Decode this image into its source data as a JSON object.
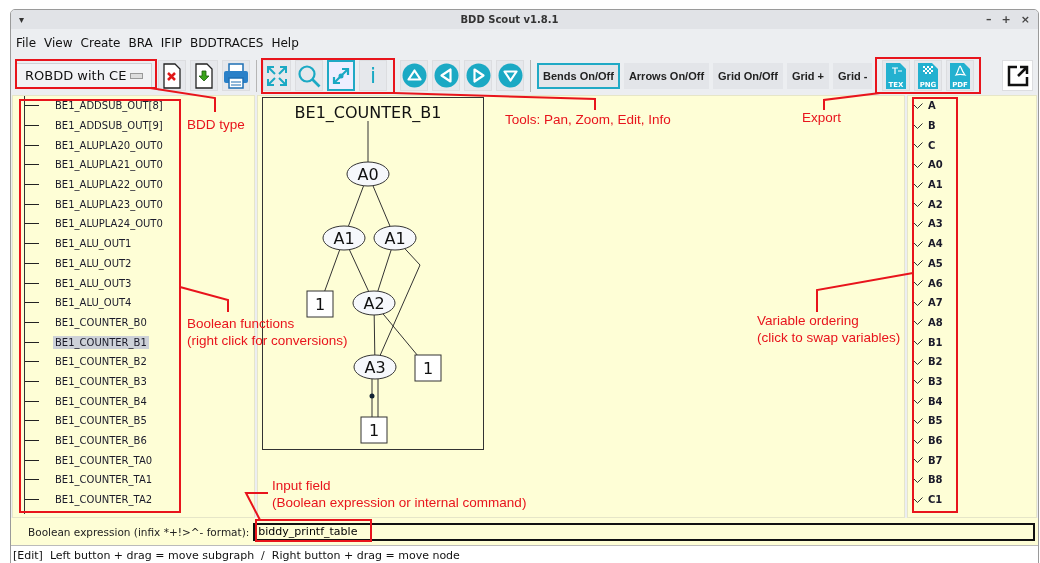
{
  "window": {
    "title": "BDD Scout v1.8.1",
    "menu_glyph": "▾",
    "controls": [
      "–",
      "+",
      "×"
    ]
  },
  "menu": [
    "File",
    "View",
    "Create",
    "BRA",
    "IFIP",
    "BDDTRACES",
    "Help"
  ],
  "toolbar": {
    "bdd_type": "ROBDD with CE",
    "file_buttons": [
      {
        "kind": "delete"
      },
      {
        "kind": "import"
      },
      {
        "kind": "print"
      }
    ],
    "tools": [
      {
        "kind": "pan",
        "selected": false
      },
      {
        "kind": "zoom",
        "selected": false
      },
      {
        "kind": "edit",
        "selected": true
      },
      {
        "kind": "info",
        "label": "i",
        "selected": false
      }
    ],
    "navigation": [
      {
        "kind": "up"
      },
      {
        "kind": "left"
      },
      {
        "kind": "right"
      },
      {
        "kind": "down"
      }
    ],
    "toggles": [
      {
        "label": "Bends On/Off",
        "selected": true
      },
      {
        "label": "Arrows On/Off",
        "selected": false
      },
      {
        "label": "Grid On/Off",
        "selected": false
      },
      {
        "label": "Grid +",
        "selected": false
      },
      {
        "label": "Grid -",
        "selected": false
      }
    ],
    "export": [
      {
        "label": "TEX",
        "kind": "tex"
      },
      {
        "label": "PNG",
        "kind": "png"
      },
      {
        "label": "PDF",
        "kind": "pdf"
      }
    ]
  },
  "functions": [
    {
      "label": "BE1_ADDSUB_OUT[8]",
      "selected": false
    },
    {
      "label": "BE1_ADDSUB_OUT[9]",
      "selected": false
    },
    {
      "label": "BE1_ALUPLA20_OUT0",
      "selected": false
    },
    {
      "label": "BE1_ALUPLA21_OUT0",
      "selected": false
    },
    {
      "label": "BE1_ALUPLA22_OUT0",
      "selected": false
    },
    {
      "label": "BE1_ALUPLA23_OUT0",
      "selected": false
    },
    {
      "label": "BE1_ALUPLA24_OUT0",
      "selected": false
    },
    {
      "label": "BE1_ALU_OUT1",
      "selected": false
    },
    {
      "label": "BE1_ALU_OUT2",
      "selected": false
    },
    {
      "label": "BE1_ALU_OUT3",
      "selected": false
    },
    {
      "label": "BE1_ALU_OUT4",
      "selected": false
    },
    {
      "label": "BE1_COUNTER_B0",
      "selected": false
    },
    {
      "label": "BE1_COUNTER_B1",
      "selected": true
    },
    {
      "label": "BE1_COUNTER_B2",
      "selected": false
    },
    {
      "label": "BE1_COUNTER_B3",
      "selected": false
    },
    {
      "label": "BE1_COUNTER_B4",
      "selected": false
    },
    {
      "label": "BE1_COUNTER_B5",
      "selected": false
    },
    {
      "label": "BE1_COUNTER_B6",
      "selected": false
    },
    {
      "label": "BE1_COUNTER_TA0",
      "selected": false
    },
    {
      "label": "BE1_COUNTER_TA1",
      "selected": false
    },
    {
      "label": "BE1_COUNTER_TA2",
      "selected": false
    }
  ],
  "graph": {
    "title": "BE1_COUNTER_B1",
    "nodes": [
      {
        "label": "A0",
        "kind": "variable"
      },
      {
        "label": "A1",
        "kind": "variable"
      },
      {
        "label": "A1",
        "kind": "variable"
      },
      {
        "label": "1",
        "kind": "terminal"
      },
      {
        "label": "A2",
        "kind": "variable"
      },
      {
        "label": "1",
        "kind": "terminal"
      },
      {
        "label": "A3",
        "kind": "variable"
      },
      {
        "label": "1",
        "kind": "terminal"
      }
    ]
  },
  "variables": [
    "A",
    "B",
    "C",
    "A0",
    "A1",
    "A2",
    "A3",
    "A4",
    "A5",
    "A6",
    "A7",
    "A8",
    "B1",
    "B2",
    "B3",
    "B4",
    "B5",
    "B6",
    "B7",
    "B8",
    "C1"
  ],
  "input": {
    "label": "Boolean expression (infix *+!>^- format):",
    "value": "biddy_printf_table"
  },
  "status_bar": "[Edit]  Left button + drag = move subgraph  /  Right button + drag = move node",
  "annotations": [
    {
      "text": "BDD type"
    },
    {
      "text": "Tools: Pan, Zoom, Edit, Info"
    },
    {
      "text": "Export"
    },
    {
      "text": "Boolean functions\n(right click for conversions)"
    },
    {
      "text": "Variable ordering\n(click to swap variables)"
    },
    {
      "text": "Input field\n(Boolean expression or internal command)"
    }
  ]
}
